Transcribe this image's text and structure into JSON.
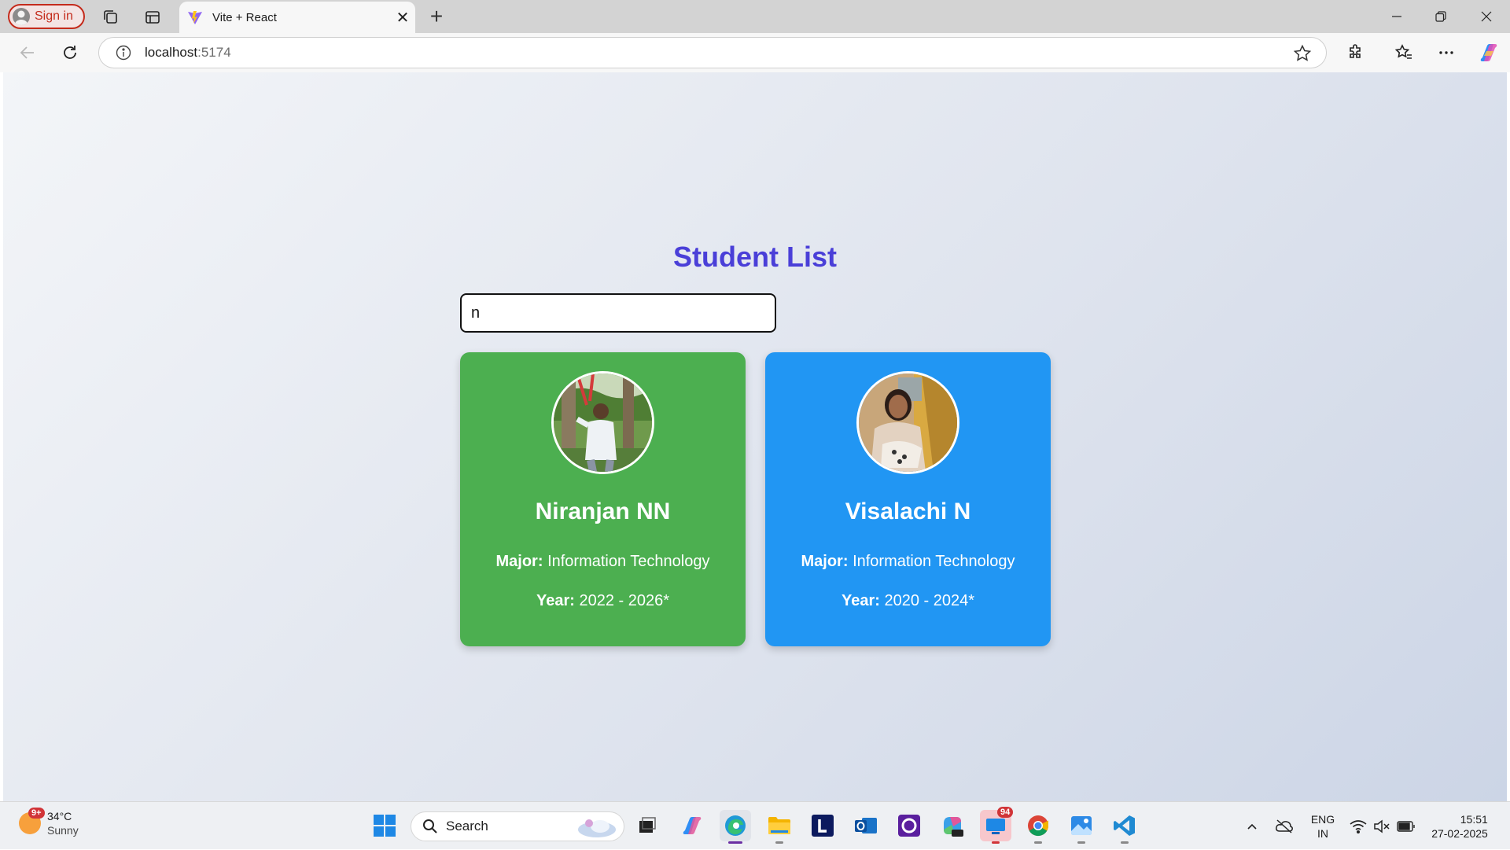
{
  "browser": {
    "signin_label": "Sign in",
    "tab_title": "Vite + React",
    "url_host": "localhost",
    "url_port": ":5174"
  },
  "page": {
    "title": "Student List",
    "search_value": "n",
    "students": [
      {
        "name": "Niranjan NN",
        "major_label": "Major:",
        "major": "Information Technology",
        "year_label": "Year:",
        "year": "2022 - 2026*",
        "card_color": "#4caf50"
      },
      {
        "name": "Visalachi N",
        "major_label": "Major:",
        "major": "Information Technology",
        "year_label": "Year:",
        "year": "2020 - 2024*",
        "card_color": "#2196f3"
      }
    ]
  },
  "taskbar": {
    "weather_badge": "9+",
    "temperature": "34°C",
    "condition": "Sunny",
    "search_label": "Search",
    "outlook_badge": "94",
    "lang_top": "ENG",
    "lang_bottom": "IN",
    "time": "15:51",
    "date": "27-02-2025"
  },
  "colors": {
    "title": "#4a3fd8",
    "signin_red": "#c42b1c"
  }
}
